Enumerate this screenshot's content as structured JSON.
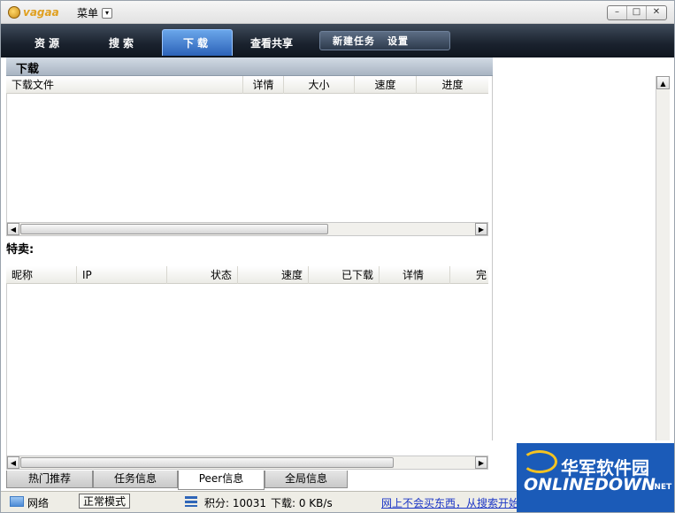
{
  "app": {
    "logo_text": "vagaa",
    "menu_label": "菜单"
  },
  "window_controls": {
    "minimize": "–",
    "restore": "□",
    "close": "✕"
  },
  "tabs": [
    {
      "label": "资源"
    },
    {
      "label": "搜索"
    },
    {
      "label": "下载"
    },
    {
      "label": "查看共享"
    }
  ],
  "subtabs": [
    {
      "label": "新建任务"
    },
    {
      "label": "设置"
    }
  ],
  "download": {
    "header": "下载",
    "columns": [
      "下载文件",
      "详情",
      "大小",
      "速度",
      "进度"
    ]
  },
  "special": {
    "label": "特卖:",
    "columns": [
      "昵称",
      "IP",
      "状态",
      "速度",
      "已下载",
      "详情",
      "完"
    ]
  },
  "bottom_tabs": [
    {
      "label": "热门推荐"
    },
    {
      "label": "任务信息"
    },
    {
      "label": "Peer信息"
    },
    {
      "label": "全局信息"
    }
  ],
  "status": {
    "network": "网络",
    "mode": "正常模式",
    "points": "积分: 10031",
    "download_speed": "下载: 0 KB/s",
    "ticker": "网上不会买东西，从搜索开始"
  },
  "watermark": {
    "cn": "华军软件园",
    "en": "ONLINEDOWN",
    "net": ".NET"
  }
}
